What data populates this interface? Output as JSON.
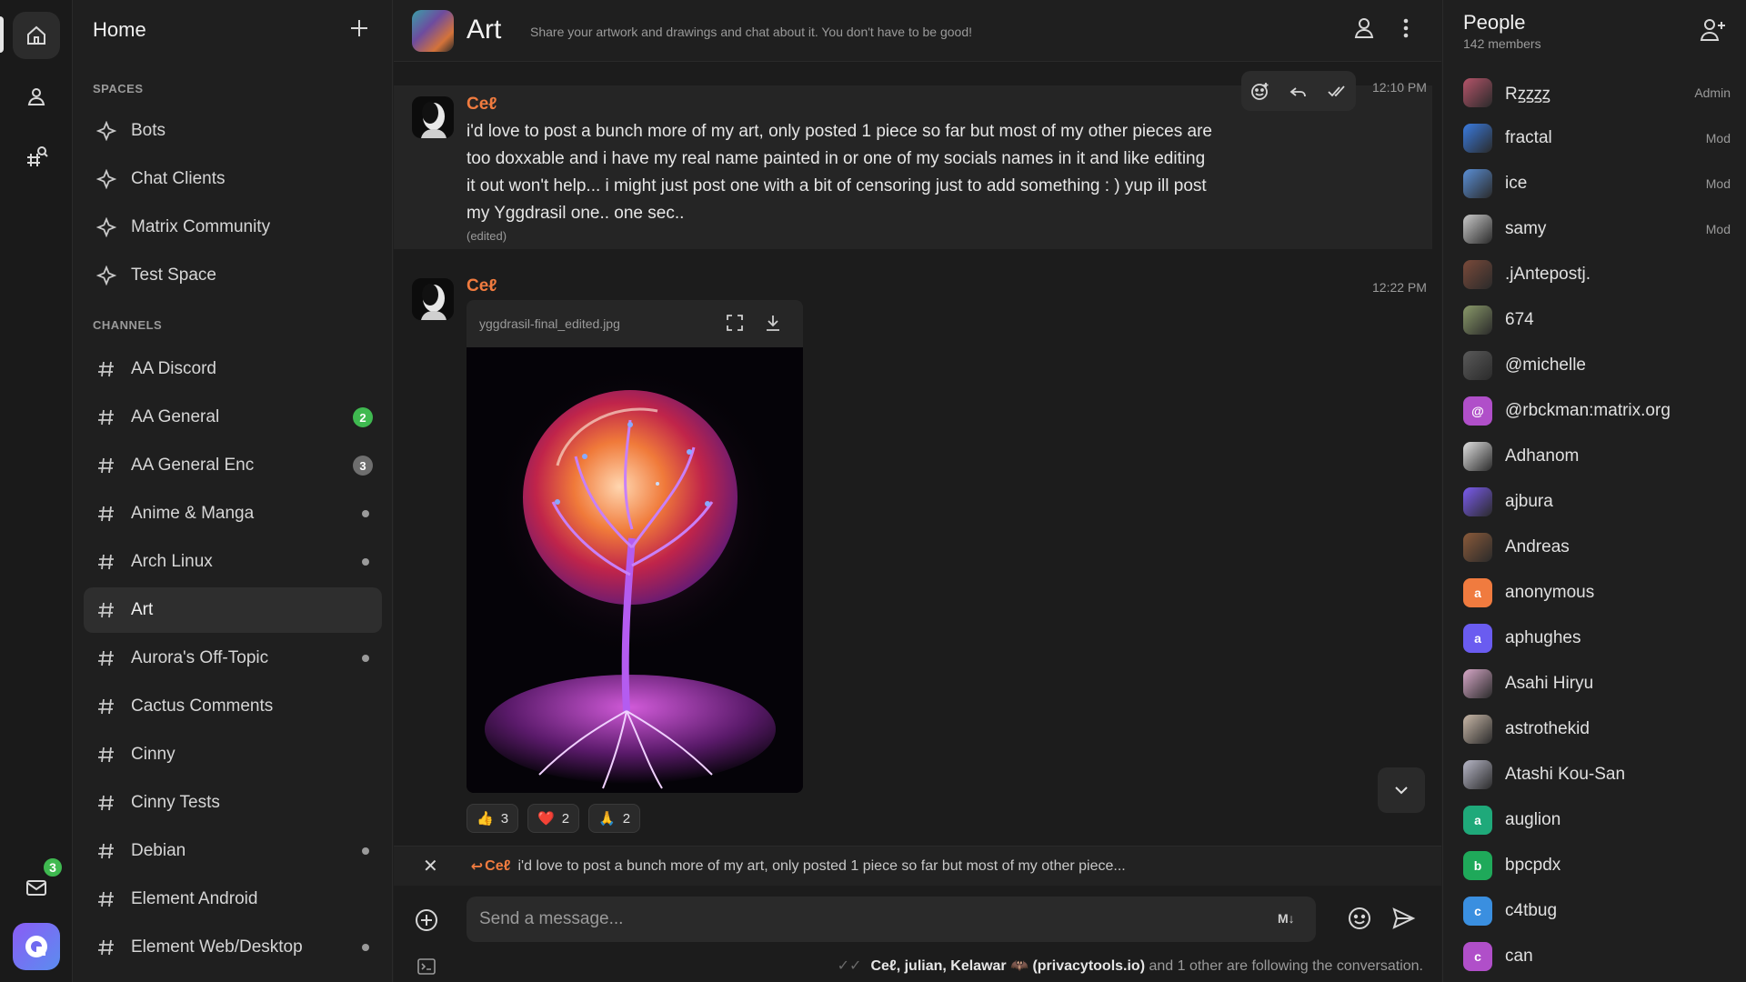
{
  "sidebar": {
    "title": "Home",
    "spaces_heading": "SPACES",
    "spaces": [
      {
        "label": "Bots"
      },
      {
        "label": "Chat Clients"
      },
      {
        "label": "Matrix Community"
      },
      {
        "label": "Test Space"
      }
    ],
    "channels_heading": "CHANNELS",
    "channels": [
      {
        "label": "AA Discord",
        "indicator": "none"
      },
      {
        "label": "AA General",
        "indicator": "badge",
        "badge": "2",
        "badge_color": "#3fb950"
      },
      {
        "label": "AA General Enc",
        "indicator": "badge",
        "badge": "3",
        "badge_color": "#6e6e6e"
      },
      {
        "label": "Anime & Manga",
        "indicator": "dot"
      },
      {
        "label": "Arch Linux",
        "indicator": "dot"
      },
      {
        "label": "Art",
        "indicator": "none",
        "active": true
      },
      {
        "label": "Aurora's Off-Topic",
        "indicator": "dot"
      },
      {
        "label": "Cactus Comments",
        "indicator": "none"
      },
      {
        "label": "Cinny",
        "indicator": "none"
      },
      {
        "label": "Cinny Tests",
        "indicator": "none"
      },
      {
        "label": "Debian",
        "indicator": "dot"
      },
      {
        "label": "Element Android",
        "indicator": "none"
      },
      {
        "label": "Element Web/Desktop",
        "indicator": "dot"
      }
    ]
  },
  "rail": {
    "mail_badge": "3"
  },
  "room": {
    "name": "Art",
    "topic": "Share your artwork and drawings and chat about it. You don't have to be good!"
  },
  "messages": [
    {
      "sender": "Ceℓ",
      "time": "12:10 PM",
      "body": "i'd love to post a bunch more of my art, only posted 1 piece so far but most of my other pieces are too doxxable and i have my real name painted in or one of my socials names in it and like editing it out won't help... i might just post one with a bit of censoring just to add something : )  yup ill post my Yggdrasil one.. one sec..",
      "edited_label": "(edited)"
    },
    {
      "sender": "Ceℓ",
      "time": "12:22 PM",
      "attachment_name": "yggdrasil-final_edited.jpg",
      "reactions": [
        {
          "emoji": "👍",
          "count": "3"
        },
        {
          "emoji": "❤️",
          "count": "2"
        },
        {
          "emoji": "🙏",
          "count": "2"
        }
      ]
    }
  ],
  "reply": {
    "sender": "Ceℓ",
    "text": "i'd love to post a bunch more of my art, only posted 1 piece so far but most of my other piece..."
  },
  "composer": {
    "placeholder": "Send a message...",
    "markdown_label": "M↓"
  },
  "following": {
    "names": "Ceℓ, julian, Kelawar 🦇 (privacytools.io)",
    "suffix": " and 1 other are following the conversation."
  },
  "people": {
    "title": "People",
    "count": "142 members",
    "members": [
      {
        "name": "Rꙁꙁꙁꙁ",
        "role": "Admin",
        "avatar": "photo",
        "color": "#b5546a"
      },
      {
        "name": "fractal",
        "role": "Mod",
        "avatar": "photo",
        "color": "#3a7be0"
      },
      {
        "name": "ice",
        "role": "Mod",
        "avatar": "photo",
        "color": "#5a8fd6"
      },
      {
        "name": "samy",
        "role": "Mod",
        "avatar": "photo",
        "color": "#c9c9c9"
      },
      {
        "name": ".jAntepostj.",
        "role": "",
        "avatar": "photo",
        "color": "#7a4a3a"
      },
      {
        "name": "674",
        "role": "",
        "avatar": "photo",
        "color": "#8a9a6a"
      },
      {
        "name": "@michelle",
        "role": "",
        "avatar": "photo",
        "color": "#5a5a5a"
      },
      {
        "name": "@rbckman:matrix.org",
        "role": "",
        "avatar": "letter",
        "letter": "@",
        "color": "#b04fc9"
      },
      {
        "name": "Adhanom",
        "role": "",
        "avatar": "photo",
        "color": "#e0e0e0"
      },
      {
        "name": "ajbura",
        "role": "",
        "avatar": "photo",
        "color": "#7b5cf0"
      },
      {
        "name": "Andreas",
        "role": "",
        "avatar": "photo",
        "color": "#8a5a3a"
      },
      {
        "name": "anonymous",
        "role": "",
        "avatar": "letter",
        "letter": "a",
        "color": "#f07b3f"
      },
      {
        "name": "aphughes",
        "role": "",
        "avatar": "letter",
        "letter": "a",
        "color": "#6a5cf0"
      },
      {
        "name": "Asahi Hiryu",
        "role": "",
        "avatar": "photo",
        "color": "#d7a8c8"
      },
      {
        "name": "astrothekid",
        "role": "",
        "avatar": "photo",
        "color": "#c9b8a8"
      },
      {
        "name": "Atashi Kou-San",
        "role": "",
        "avatar": "photo",
        "color": "#b8b8c8"
      },
      {
        "name": "auglion",
        "role": "",
        "avatar": "letter",
        "letter": "a",
        "color": "#1fa97a"
      },
      {
        "name": "bpcpdx",
        "role": "",
        "avatar": "letter",
        "letter": "b",
        "color": "#1fa95a"
      },
      {
        "name": "c4tbug",
        "role": "",
        "avatar": "letter",
        "letter": "c",
        "color": "#3a8fe0"
      },
      {
        "name": "can",
        "role": "",
        "avatar": "letter",
        "letter": "c",
        "color": "#b04fc9"
      }
    ]
  }
}
